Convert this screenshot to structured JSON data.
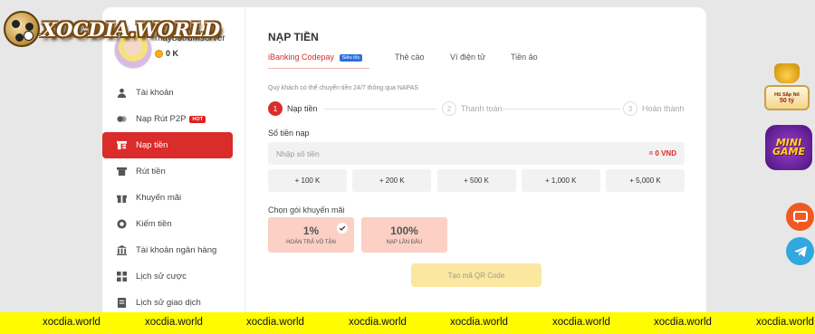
{
  "brand": {
    "logo_text": "XOCDIA.WORLD"
  },
  "user": {
    "username": "may88trumserver",
    "balance": "0 K"
  },
  "sidebar": {
    "items": [
      {
        "label": "Tài khoản",
        "icon": "user-icon"
      },
      {
        "label": "Nạp Rút P2P",
        "icon": "p2p-icon",
        "badge": "HOT"
      },
      {
        "label": "Nạp tiền",
        "icon": "deposit-icon",
        "active": true
      },
      {
        "label": "Rút tiền",
        "icon": "withdraw-icon"
      },
      {
        "label": "Khuyến mãi",
        "icon": "gift-icon"
      },
      {
        "label": "Kiếm tiền",
        "icon": "earn-icon"
      },
      {
        "label": "Tài khoản ngân hàng",
        "icon": "bank-icon"
      },
      {
        "label": "Lịch sử cược",
        "icon": "bet-history-icon"
      },
      {
        "label": "Lịch sử giao dịch",
        "icon": "transaction-history-icon"
      }
    ]
  },
  "main": {
    "title": "NẠP TIỀN",
    "tabs": [
      {
        "label": "iBanking Codepay",
        "badge": "Siêu tốc",
        "active": true
      },
      {
        "label": "Thẻ cào"
      },
      {
        "label": "Ví điện tử"
      },
      {
        "label": "Tiền ảo"
      }
    ],
    "notice": "Quý khách có thể chuyển tiền 24/7 thông qua NAPAS",
    "steps": [
      {
        "num": "1",
        "label": "Nạp tiền",
        "active": true
      },
      {
        "num": "2",
        "label": "Thanh toán"
      },
      {
        "num": "3",
        "label": "Hoàn thành"
      }
    ],
    "amount": {
      "label": "Số tiền nạp",
      "placeholder": "Nhập số tiền",
      "total": "= 0 VND"
    },
    "presets": [
      "+ 100 K",
      "+ 200 K",
      "+ 500 K",
      "+ 1,000 K",
      "+ 5,000 K"
    ],
    "promo": {
      "label": "Chọn gói khuyến mãi",
      "options": [
        {
          "percent": "1%",
          "name": "HOÀN TRẢ VÔ TẬN",
          "selected": true
        },
        {
          "percent": "100%",
          "name": "NẠP LẦN ĐẦU",
          "selected": false
        }
      ]
    },
    "submit_label": "Tạo mã QR Code"
  },
  "widgets": {
    "jackpot_line1": "Hũ Sắp Nổ",
    "jackpot_line2": "50 tỷ",
    "minigame_line1": "MINI",
    "minigame_line2": "GAME"
  },
  "ticker": {
    "items": [
      "xocdia.world",
      "xocdia.world",
      "xocdia.world",
      "xocdia.world",
      "xocdia.world",
      "xocdia.world",
      "xocdia.world",
      "xocdia.world"
    ]
  },
  "colors": {
    "accent": "#db2c2c",
    "ticker_bg": "#fffb00",
    "qr_button": "#fbe7a0",
    "promo_bg": "#fcd0c4"
  }
}
